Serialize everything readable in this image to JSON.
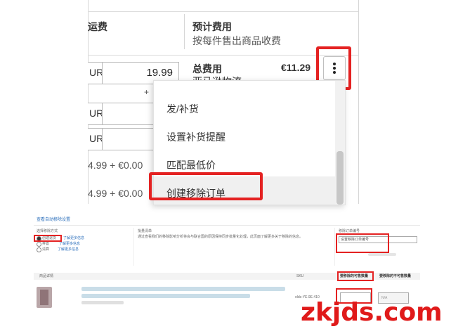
{
  "top": {
    "col_shipping_header": "运费",
    "col_estimate_header": "预计费用",
    "col_estimate_sub": "按每件售出商品收费",
    "total_label": "总费用",
    "total_value": "€11.29",
    "total_sub": "亚马逊物流...",
    "price_value": "19.99",
    "currency_partial": "UR",
    "plus_sign": "+",
    "fee_rows": [
      "4.99 + €0.00",
      "4.99 + €0.00"
    ],
    "menu": {
      "items": [
        "发/补货",
        "设置补货提醒",
        "匹配最低价",
        "创建移除订单"
      ]
    }
  },
  "bottom": {
    "section_title": "查看自动移除设置",
    "method_label": "选择移除方式",
    "method_options": [
      {
        "label": "创建退货",
        "link": "了解更多信息"
      },
      {
        "label": "弃置",
        "link": "了解更多信息"
      },
      {
        "label": "清算",
        "link": "了解更多信息"
      }
    ],
    "batch_label": "批量清单",
    "batch_text": "通过查看我们的移除影响分析将会与联合国的原因保持同步批量化处理，此页面了解更多关于移除的信息。",
    "order_id_label": "移除订单编号",
    "order_id_placeholder": "设置移除订单编号",
    "table_headers": [
      "商品详情",
      "SKU",
      "要移除的可售数量",
      "要移除的不可售数量"
    ],
    "na_value": "N/A",
    "sku_value": "olds-YE.9E.410"
  },
  "watermark": "zkjds.com",
  "colors": {
    "highlight": "#e42222",
    "link": "#2a6ebb",
    "watermark": "#e01a1a"
  }
}
